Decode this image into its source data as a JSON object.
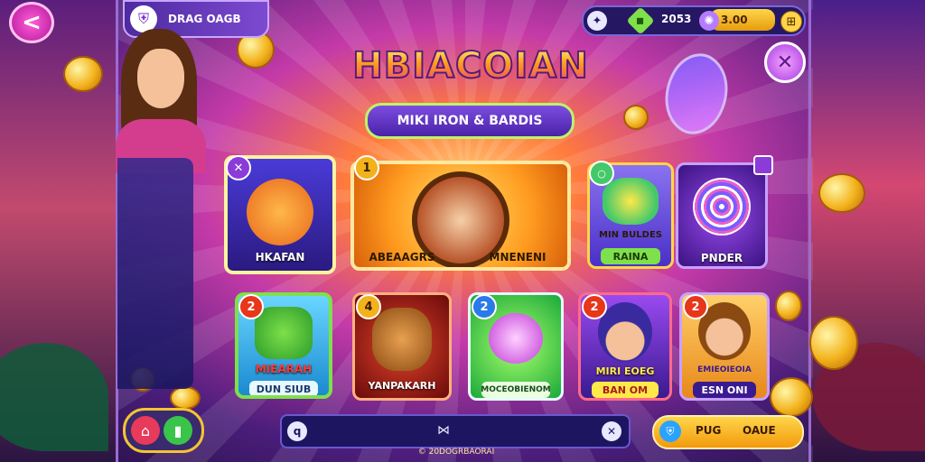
{
  "player": {
    "name": "DRAG OAGB",
    "icon": "shield-icon"
  },
  "resources": {
    "gem_value": "2053",
    "coin_value": "3.00"
  },
  "title": "HBIACOIAN",
  "subtitle": "MIKI IRON & BARDIS",
  "cards": [
    {
      "name": "HKAFAN",
      "badge": "✕",
      "color": "#4a3bd8"
    },
    {
      "name_left": "ABEAAGRS",
      "name_right": "MNENENI",
      "badge": "1",
      "color": "#ff9a1f"
    },
    {
      "name": "MIN BULDES",
      "plate": "RAINA",
      "badge": "○",
      "color": "#7a63e8"
    },
    {
      "name": "PNDER",
      "badge": "",
      "color": "#6a2bd0"
    },
    {
      "name": "MIEARAH",
      "plate": "DUN SIUB",
      "badge": "2",
      "color": "#3ac4ff"
    },
    {
      "name": "YANPAKARH",
      "badge": "4",
      "color": "#c2261a"
    },
    {
      "name": "MOCEOBIENOM",
      "badge": "2",
      "color": "#27c23a"
    },
    {
      "name": "MIRI EOEG",
      "plate": "BAN OM",
      "badge": "2",
      "color": "#7c2ae0"
    },
    {
      "name": "EMIEOIEOIA",
      "plate": "ESN ONI",
      "badge": "2",
      "color": "#ffb52a"
    }
  ],
  "bottom_bar": {
    "left_icon": "q",
    "right_icon": "✕"
  },
  "footer": "© 20DOGRBAORAI",
  "play": {
    "label_left": "PUG",
    "label_right": "OAUE"
  }
}
